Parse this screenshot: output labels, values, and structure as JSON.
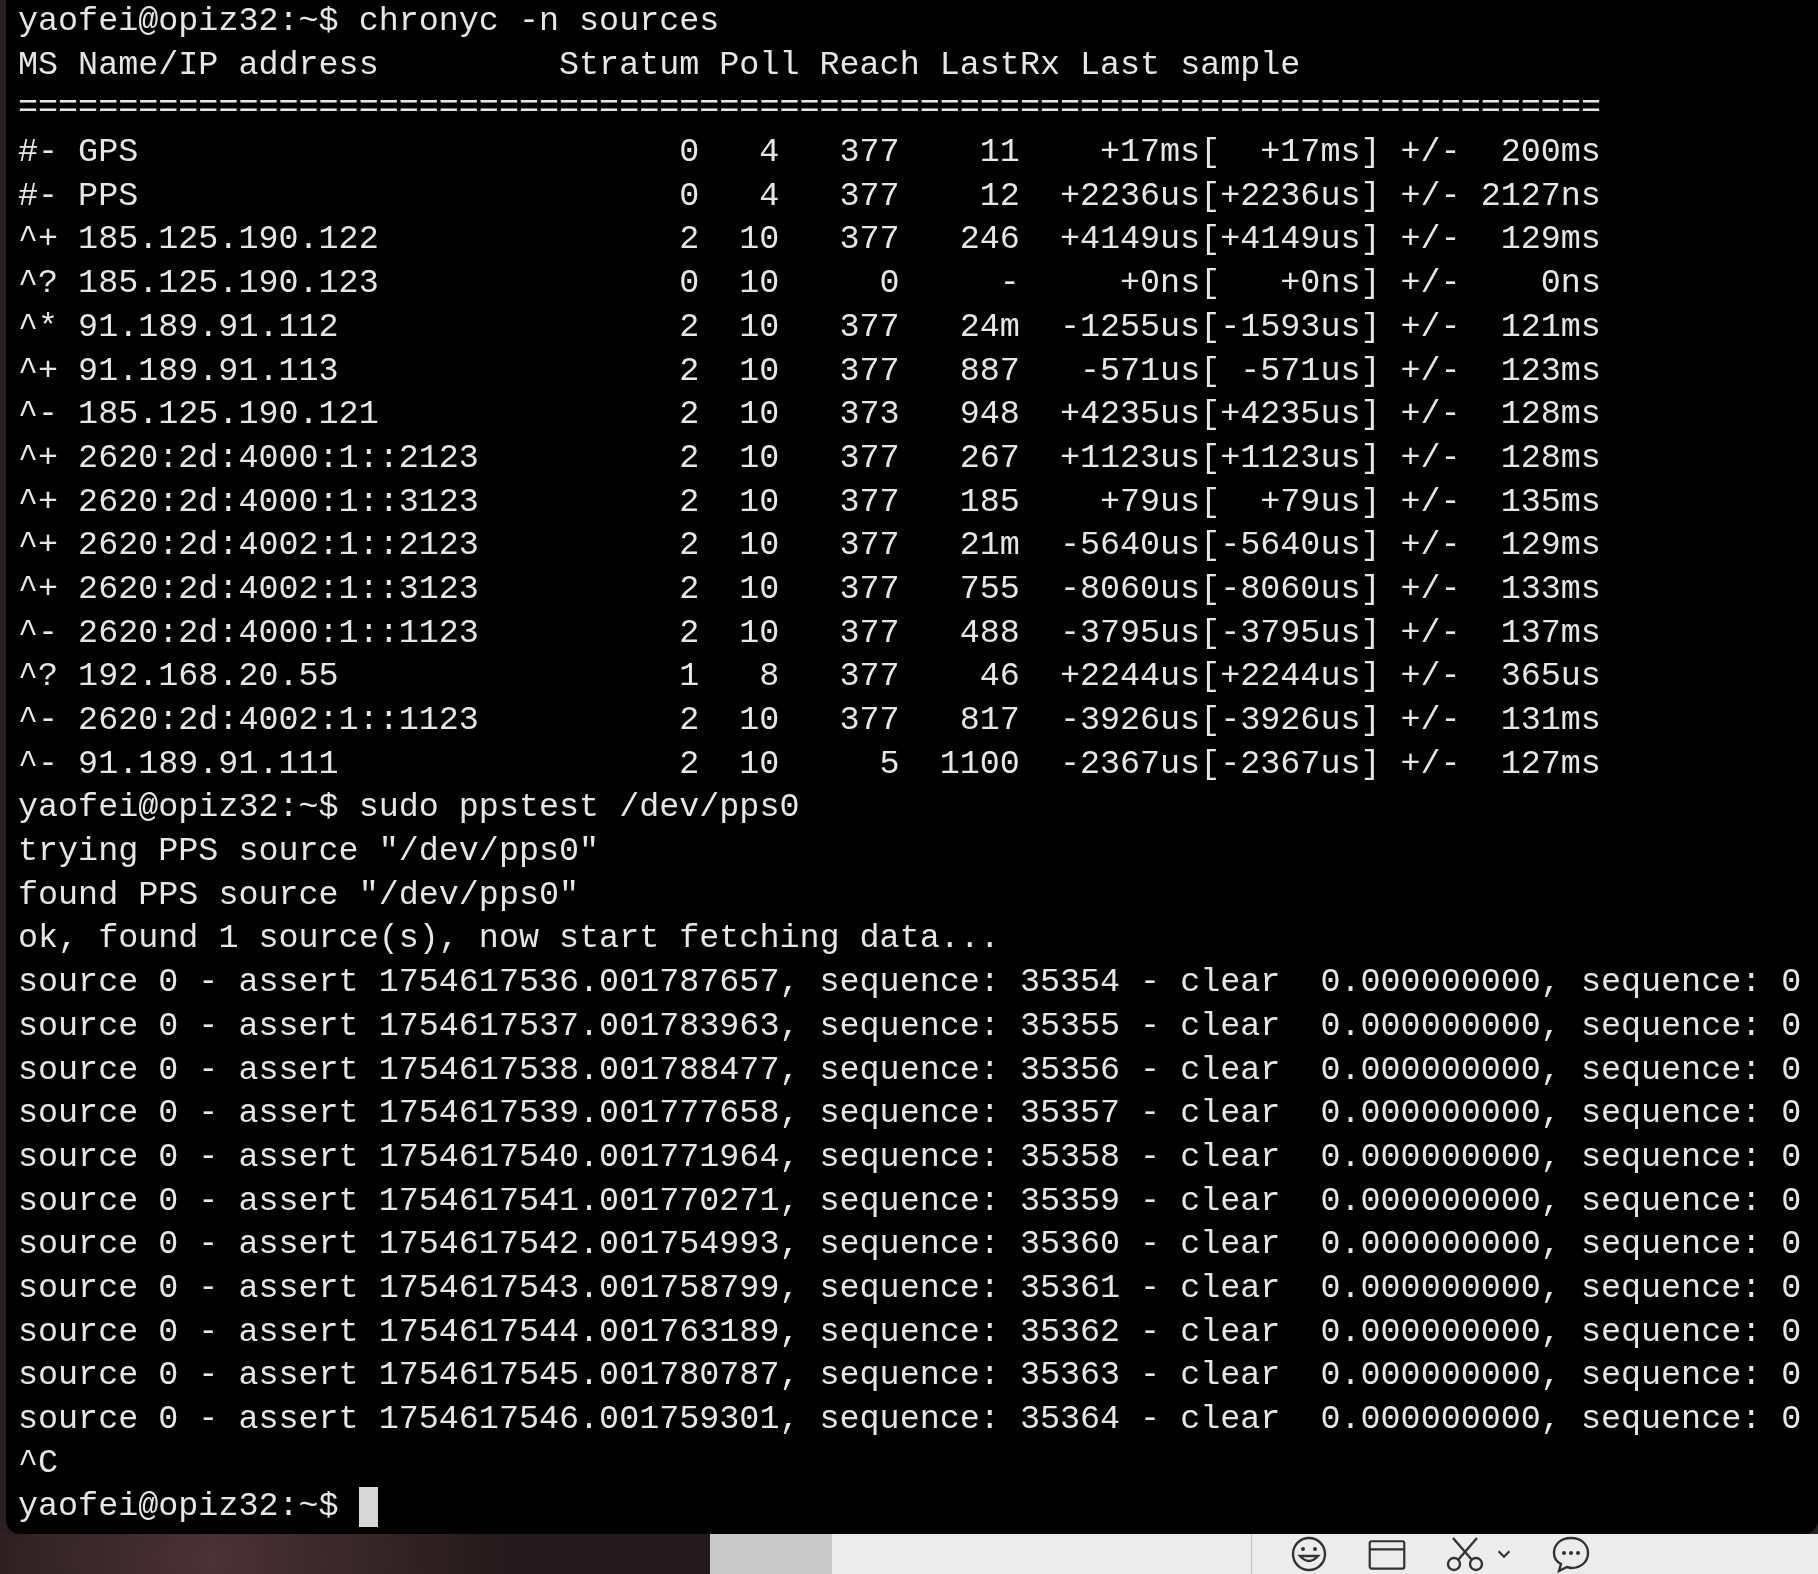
{
  "terminal": {
    "lines": [
      {
        "kind": "text",
        "text": "yaofei@opiz32:~$ chronyc -n sources"
      },
      {
        "kind": "text",
        "text": "MS Name/IP address         Stratum Poll Reach LastRx Last sample"
      },
      {
        "kind": "text",
        "text": "==============================================================================="
      },
      {
        "kind": "row",
        "ms": "#-",
        "name": "GPS",
        "stratum": "0",
        "poll": "4",
        "reach": "377",
        "last_rx": "11",
        "last_sample": "+17ms[  +17ms] +/-  200ms"
      },
      {
        "kind": "row",
        "ms": "#-",
        "name": "PPS",
        "stratum": "0",
        "poll": "4",
        "reach": "377",
        "last_rx": "12",
        "last_sample": "+2236us[+2236us] +/- 2127ns"
      },
      {
        "kind": "row",
        "ms": "^+",
        "name": "185.125.190.122",
        "stratum": "2",
        "poll": "10",
        "reach": "377",
        "last_rx": "246",
        "last_sample": "+4149us[+4149us] +/-  129ms"
      },
      {
        "kind": "row",
        "ms": "^?",
        "name": "185.125.190.123",
        "stratum": "0",
        "poll": "10",
        "reach": "0",
        "last_rx": "-",
        "last_sample": "+0ns[   +0ns] +/-    0ns"
      },
      {
        "kind": "row",
        "ms": "^*",
        "name": "91.189.91.112",
        "stratum": "2",
        "poll": "10",
        "reach": "377",
        "last_rx": "24m",
        "last_sample": "-1255us[-1593us] +/-  121ms"
      },
      {
        "kind": "row",
        "ms": "^+",
        "name": "91.189.91.113",
        "stratum": "2",
        "poll": "10",
        "reach": "377",
        "last_rx": "887",
        "last_sample": "-571us[ -571us] +/-  123ms"
      },
      {
        "kind": "row",
        "ms": "^-",
        "name": "185.125.190.121",
        "stratum": "2",
        "poll": "10",
        "reach": "373",
        "last_rx": "948",
        "last_sample": "+4235us[+4235us] +/-  128ms"
      },
      {
        "kind": "row",
        "ms": "^+",
        "name": "2620:2d:4000:1::2123",
        "stratum": "2",
        "poll": "10",
        "reach": "377",
        "last_rx": "267",
        "last_sample": "+1123us[+1123us] +/-  128ms"
      },
      {
        "kind": "row",
        "ms": "^+",
        "name": "2620:2d:4000:1::3123",
        "stratum": "2",
        "poll": "10",
        "reach": "377",
        "last_rx": "185",
        "last_sample": "+79us[  +79us] +/-  135ms"
      },
      {
        "kind": "row",
        "ms": "^+",
        "name": "2620:2d:4002:1::2123",
        "stratum": "2",
        "poll": "10",
        "reach": "377",
        "last_rx": "21m",
        "last_sample": "-5640us[-5640us] +/-  129ms"
      },
      {
        "kind": "row",
        "ms": "^+",
        "name": "2620:2d:4002:1::3123",
        "stratum": "2",
        "poll": "10",
        "reach": "377",
        "last_rx": "755",
        "last_sample": "-8060us[-8060us] +/-  133ms"
      },
      {
        "kind": "row",
        "ms": "^-",
        "name": "2620:2d:4000:1::1123",
        "stratum": "2",
        "poll": "10",
        "reach": "377",
        "last_rx": "488",
        "last_sample": "-3795us[-3795us] +/-  137ms"
      },
      {
        "kind": "row",
        "ms": "^?",
        "name": "192.168.20.55",
        "stratum": "1",
        "poll": "8",
        "reach": "377",
        "last_rx": "46",
        "last_sample": "+2244us[+2244us] +/-  365us"
      },
      {
        "kind": "row",
        "ms": "^-",
        "name": "2620:2d:4002:1::1123",
        "stratum": "2",
        "poll": "10",
        "reach": "377",
        "last_rx": "817",
        "last_sample": "-3926us[-3926us] +/-  131ms"
      },
      {
        "kind": "row",
        "ms": "^-",
        "name": "91.189.91.111",
        "stratum": "2",
        "poll": "10",
        "reach": "5",
        "last_rx": "1100",
        "last_sample": "-2367us[-2367us] +/-  127ms"
      },
      {
        "kind": "text",
        "text": "yaofei@opiz32:~$ sudo ppstest /dev/pps0"
      },
      {
        "kind": "text",
        "text": "trying PPS source \"/dev/pps0\""
      },
      {
        "kind": "text",
        "text": "found PPS source \"/dev/pps0\""
      },
      {
        "kind": "text",
        "text": "ok, found 1 source(s), now start fetching data..."
      },
      {
        "kind": "text",
        "text": "source 0 - assert 1754617536.001787657, sequence: 35354 - clear  0.000000000, sequence: 0"
      },
      {
        "kind": "text",
        "text": "source 0 - assert 1754617537.001783963, sequence: 35355 - clear  0.000000000, sequence: 0"
      },
      {
        "kind": "text",
        "text": "source 0 - assert 1754617538.001788477, sequence: 35356 - clear  0.000000000, sequence: 0"
      },
      {
        "kind": "text",
        "text": "source 0 - assert 1754617539.001777658, sequence: 35357 - clear  0.000000000, sequence: 0"
      },
      {
        "kind": "text",
        "text": "source 0 - assert 1754617540.001771964, sequence: 35358 - clear  0.000000000, sequence: 0"
      },
      {
        "kind": "text",
        "text": "source 0 - assert 1754617541.001770271, sequence: 35359 - clear  0.000000000, sequence: 0"
      },
      {
        "kind": "text",
        "text": "source 0 - assert 1754617542.001754993, sequence: 35360 - clear  0.000000000, sequence: 0"
      },
      {
        "kind": "text",
        "text": "source 0 - assert 1754617543.001758799, sequence: 35361 - clear  0.000000000, sequence: 0"
      },
      {
        "kind": "text",
        "text": "source 0 - assert 1754617544.001763189, sequence: 35362 - clear  0.000000000, sequence: 0"
      },
      {
        "kind": "text",
        "text": "source 0 - assert 1754617545.001780787, sequence: 35363 - clear  0.000000000, sequence: 0"
      },
      {
        "kind": "text",
        "text": "source 0 - assert 1754617546.001759301, sequence: 35364 - clear  0.000000000, sequence: 0"
      },
      {
        "kind": "text",
        "text": "^C"
      },
      {
        "kind": "prompt",
        "text": "yaofei@opiz32:~$"
      }
    ]
  }
}
